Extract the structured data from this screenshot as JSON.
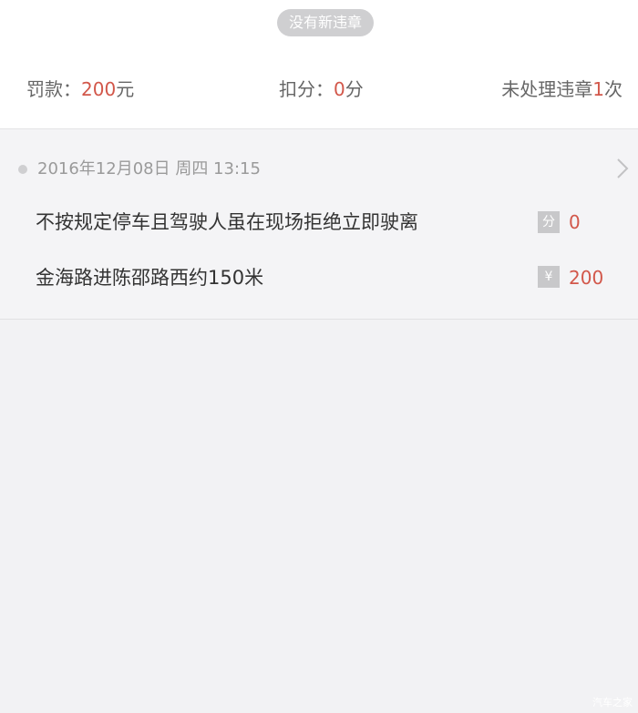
{
  "header": {
    "status_label": "没有新违章"
  },
  "summary": {
    "fine_label": "罚款：",
    "fine_value": "200",
    "fine_unit": "元",
    "points_label": "扣分：",
    "points_value": "0",
    "points_unit": "分",
    "unhandled_label": "未处理违章",
    "unhandled_value": "1",
    "unhandled_unit": "次"
  },
  "violations": [
    {
      "datetime": "2016年12月08日 周四 13:15",
      "reason": "不按规定停车且驾驶人虽在现场拒绝立即驶离",
      "location": "金海路进陈邵路西约150米",
      "points_tag": "分",
      "points": "0",
      "money_tag": "¥",
      "money": "200"
    }
  ],
  "watermark": "汽车之家",
  "colors": {
    "accent": "#d2574a",
    "pill_bg": "#cfcfd1",
    "page_bg": "#f2f2f4"
  },
  "icons": {
    "chevron": "chevron-right-icon",
    "bullet": "timeline-dot-icon"
  }
}
